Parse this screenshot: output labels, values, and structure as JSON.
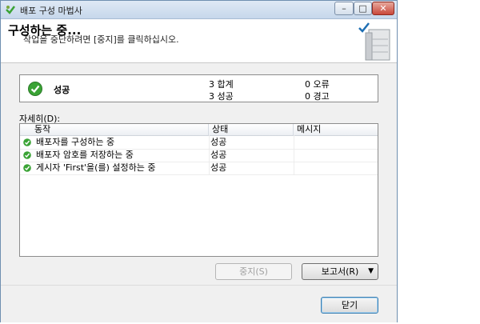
{
  "window": {
    "title": "배포 구성 마법사",
    "controls": {
      "minimize": "–",
      "maximize": "□",
      "close": "✕"
    }
  },
  "header": {
    "title": "구성하는 중...",
    "subtitle": "작업을 중단하려면 [중지]를 클릭하십시오."
  },
  "summary": {
    "status": "성공",
    "total": "3 합계",
    "success": "3 성공",
    "errors": "0 오류",
    "warnings": "0 경고"
  },
  "details": {
    "label": "자세히(D):",
    "columns": [
      "동작",
      "상태",
      "메시지"
    ],
    "rows": [
      {
        "action": "배포자를 구성하는 중",
        "status": "성공",
        "message": ""
      },
      {
        "action": "배포자 암호를 저장하는 중",
        "status": "성공",
        "message": ""
      },
      {
        "action": "게시자 'First'을(를) 설정하는 중",
        "status": "성공",
        "message": ""
      }
    ]
  },
  "buttons": {
    "stop": "중지(S)",
    "report": "보고서(R)",
    "close": "닫기"
  },
  "colors": {
    "success_green": "#3aa335",
    "accent": "#3c7fb1"
  }
}
